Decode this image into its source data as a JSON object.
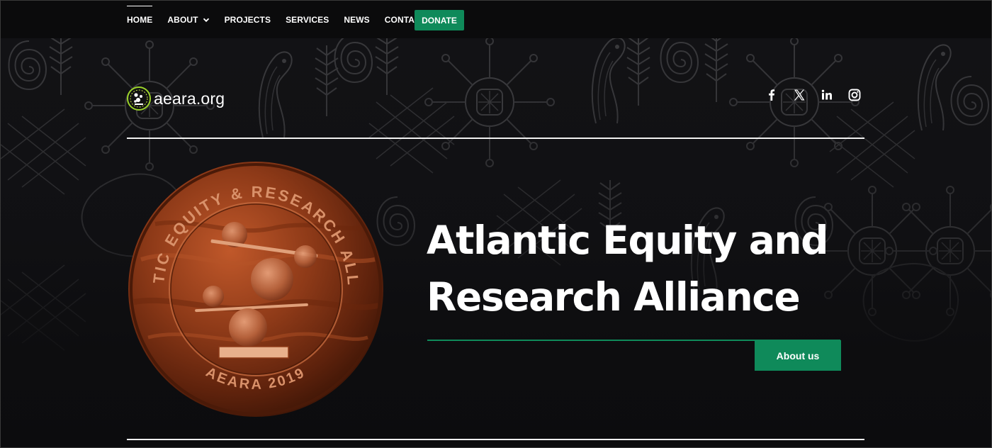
{
  "nav": {
    "items": [
      {
        "label": "HOME",
        "active": true
      },
      {
        "label": "ABOUT",
        "has_dropdown": true
      },
      {
        "label": "PROJECTS"
      },
      {
        "label": "SERVICES"
      },
      {
        "label": "NEWS"
      },
      {
        "label": "CONTACT US"
      }
    ],
    "donate_label": "DONATE"
  },
  "brand": {
    "site_name": "aeara.org",
    "logo_icon": "aeara-logo-icon"
  },
  "socials": [
    {
      "name": "facebook-icon"
    },
    {
      "name": "x-twitter-icon"
    },
    {
      "name": "linkedin-icon"
    },
    {
      "name": "instagram-icon"
    }
  ],
  "seal": {
    "top_text": "ATLANTIC EQUITY & RESEARCH ALLIANCE",
    "bottom_text": "AEARA 2019"
  },
  "hero": {
    "title_line1": "Atlantic Equity and",
    "title_line2": "Research Alliance",
    "cta_label": "About us"
  },
  "colors": {
    "accent": "#0f8a5a",
    "background": "#0d0d0f",
    "text": "#ffffff",
    "coin": "#8a3a1c"
  }
}
